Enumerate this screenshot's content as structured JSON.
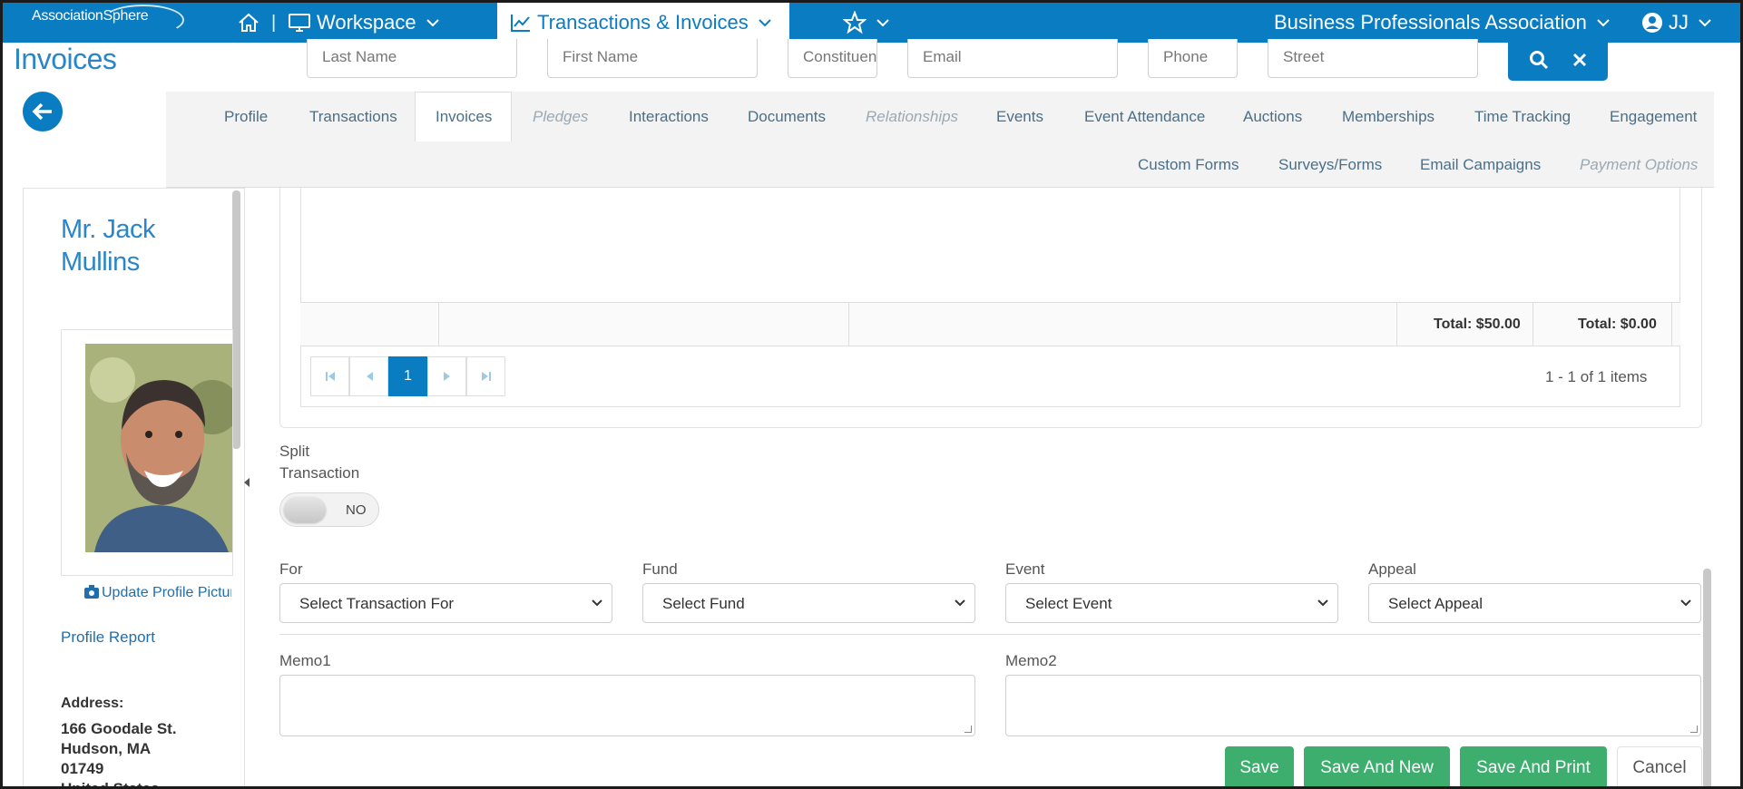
{
  "topnav": {
    "logo": "AssociationSphere",
    "divider": "|",
    "workspace_label": "Workspace",
    "transactions_label": "Transactions & Invoices",
    "org_name": "Business Professionals Association",
    "user_initials": "JJ",
    "colors": {
      "bar": "#0a7cc1"
    }
  },
  "page_title": "Invoices",
  "search": {
    "last_name": "Last Name",
    "first_name": "First Name",
    "constituent": "Constituent",
    "email": "Email",
    "phone": "Phone",
    "street": "Street"
  },
  "tabs": {
    "row1": [
      "Profile",
      "Transactions",
      "Invoices",
      "Pledges",
      "Interactions",
      "Documents",
      "Relationships",
      "Events",
      "Event Attendance",
      "Auctions",
      "Memberships",
      "Time Tracking",
      "Engagement"
    ],
    "row2": [
      "Custom Forms",
      "Surveys/Forms",
      "Email Campaigns",
      "Payment Options"
    ],
    "active": "Invoices",
    "disabled": [
      "Pledges",
      "Relationships",
      "Payment Options"
    ]
  },
  "profile": {
    "name": "Mr. Jack Mullins",
    "update_picture": "Update Profile Picture",
    "profile_report": "Profile Report",
    "address_label": "Address:",
    "address_line1": "166 Goodale St.",
    "address_line2": "Hudson, MA",
    "address_line3": "01749",
    "address_line4": "United States"
  },
  "grid": {
    "total1": "Total: $50.00",
    "total2": "Total: $0.00",
    "current_page": "1",
    "page_info": "1 - 1 of 1 items"
  },
  "form": {
    "split_label_1": "Split",
    "split_label_2": "Transaction",
    "split_state": "NO",
    "for_label": "For",
    "for_value": "Select Transaction For",
    "fund_label": "Fund",
    "fund_value": "Select Fund",
    "event_label": "Event",
    "event_value": "Select Event",
    "appeal_label": "Appeal",
    "appeal_value": "Select Appeal",
    "memo1_label": "Memo1",
    "memo2_label": "Memo2"
  },
  "actions": {
    "save": "Save",
    "save_and_new": "Save And New",
    "save_and_print": "Save And Print",
    "cancel": "Cancel",
    "colors": {
      "primary": "#3dae6e"
    }
  }
}
